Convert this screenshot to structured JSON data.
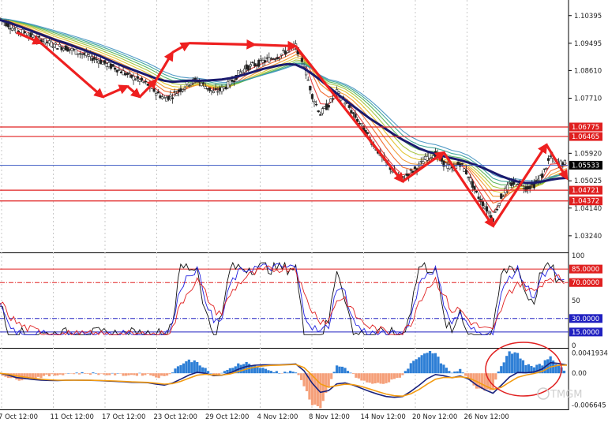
{
  "chart_data": {
    "type": "line",
    "instrument_chart": "candlestick with moving-average ribbon",
    "x_labels": [
      "7 Oct 12:00",
      "11 Oct 12:00",
      "17 Oct 12:00",
      "23 Oct 12:00",
      "29 Oct 12:00",
      "4 Nov 12:00",
      "8 Nov 12:00",
      "14 Nov 12:00",
      "20 Nov 12:00",
      "26 Nov 12:00"
    ],
    "price_axis": {
      "ticks": [
        "1.10395",
        "1.09495",
        "1.08610",
        "1.07710",
        "1.05920",
        "1.05025",
        "1.04140",
        "1.03240"
      ],
      "ylim": [
        1.0275,
        1.1085
      ],
      "current_price": "1.05533",
      "levels": [
        {
          "label": "1.06775",
          "value": 1.06775,
          "color": "#e02020",
          "tagged": true
        },
        {
          "label": "1.06465",
          "value": 1.06465,
          "color": "#e02020",
          "tagged": true
        },
        {
          "label": "1.04721",
          "value": 1.04721,
          "color": "#e02020",
          "tagged": true
        },
        {
          "label": "1.04372",
          "value": 1.04372,
          "color": "#e02020",
          "tagged": true
        }
      ],
      "current_line_color": "#3050c0",
      "series": [
        {
          "role": "close",
          "values": [
            1.103,
            1.101,
            1.099,
            1.0985,
            1.097,
            1.096,
            1.095,
            1.094,
            1.0935,
            1.0925,
            1.0915,
            1.0905,
            1.0895,
            1.088,
            1.087,
            1.0855,
            1.084,
            1.083,
            1.0815,
            1.079,
            1.077,
            1.078,
            1.08,
            1.082,
            1.083,
            1.081,
            1.079,
            1.08,
            1.082,
            1.085,
            1.087,
            1.088,
            1.089,
            1.09,
            1.091,
            1.0925,
            1.094,
            1.088,
            1.078,
            1.072,
            1.075,
            1.079,
            1.076,
            1.072,
            1.068,
            1.064,
            1.06,
            1.056,
            1.053,
            1.051,
            1.053,
            1.055,
            1.058,
            1.059,
            1.056,
            1.054,
            1.056,
            1.052,
            1.046,
            1.042,
            1.038,
            1.045,
            1.049,
            1.05,
            1.048,
            1.049,
            1.052,
            1.058,
            1.056,
            1.056
          ]
        },
        {
          "role": "ma-slow",
          "values": [
            1.1025,
            1.1018,
            1.1008,
            1.0998,
            1.0988,
            1.0978,
            1.0968,
            1.0958,
            1.095,
            1.094,
            1.093,
            1.092,
            1.091,
            1.0898,
            1.0886,
            1.0875,
            1.0865,
            1.0855,
            1.0845,
            1.0835,
            1.0828,
            1.0824,
            1.0826,
            1.0828,
            1.0828,
            1.0828,
            1.083,
            1.0832,
            1.0836,
            1.0842,
            1.085,
            1.0858,
            1.0866,
            1.0872,
            1.0878,
            1.0882,
            1.088,
            1.0868,
            1.085,
            1.083,
            1.0808,
            1.0786,
            1.0765,
            1.0745,
            1.0725,
            1.0705,
            1.0688,
            1.067,
            1.0652,
            1.0636,
            1.0622,
            1.0608,
            1.0598,
            1.059,
            1.0582,
            1.0576,
            1.057,
            1.0562,
            1.0553,
            1.0542,
            1.053,
            1.0518,
            1.0508,
            1.05,
            1.0496,
            1.0496,
            1.05,
            1.0506,
            1.051,
            1.0512
          ]
        }
      ],
      "arrows": [
        {
          "from": [
            2,
            1.0985
          ],
          "to": [
            5,
            1.095
          ]
        },
        {
          "from": [
            5,
            1.095
          ],
          "to": [
            12.5,
            1.0775
          ]
        },
        {
          "from": [
            12.5,
            1.0775
          ],
          "to": [
            15.5,
            1.081
          ]
        },
        {
          "from": [
            15.5,
            1.081
          ],
          "to": [
            17,
            1.0775
          ]
        },
        {
          "from": [
            17,
            1.0775
          ],
          "to": [
            19,
            1.083
          ]
        },
        {
          "from": [
            19,
            1.083
          ],
          "to": [
            21,
            1.092
          ]
        },
        {
          "from": [
            21,
            1.092
          ],
          "to": [
            23,
            1.095
          ]
        },
        {
          "from": [
            23,
            1.095
          ],
          "to": [
            31,
            1.0945
          ]
        },
        {
          "from": [
            31,
            1.0945
          ],
          "to": [
            36,
            1.094
          ]
        },
        {
          "from": [
            36,
            1.094
          ],
          "to": [
            49,
            1.05
          ]
        },
        {
          "from": [
            49,
            1.05
          ],
          "to": [
            54,
            1.0595
          ]
        },
        {
          "from": [
            54,
            1.0595
          ],
          "to": [
            60,
            1.0355
          ]
        },
        {
          "from": [
            60,
            1.0355
          ],
          "to": [
            66.5,
            1.062
          ]
        },
        {
          "from": [
            66.5,
            1.062
          ],
          "to": [
            69,
            1.051
          ]
        }
      ]
    },
    "stochastic_panel": {
      "ticks": [
        "100",
        "50",
        "0"
      ],
      "levels": [
        {
          "label": "85.0000",
          "value": 85,
          "color": "#e02020",
          "style": "solid"
        },
        {
          "label": "70.0000",
          "value": 70,
          "color": "#e02020",
          "style": "dashdot"
        },
        {
          "label": "30.0000",
          "value": 30,
          "color": "#2020c0",
          "style": "dashdot"
        },
        {
          "label": "15.0000",
          "value": 15,
          "color": "#2020c0",
          "style": "solid"
        }
      ],
      "ylim": [
        0,
        100
      ]
    },
    "macd_panel": {
      "ticks": [
        "0.0041934",
        "0.00",
        "-0.006645"
      ],
      "ylim": [
        -0.0072,
        0.0048
      ],
      "annotation": "red ellipse around latest histogram bars"
    },
    "colors": {
      "ribbon": [
        "#e03030",
        "#f06020",
        "#f09020",
        "#e0c020",
        "#a0c030",
        "#50b050",
        "#30a090",
        "#4090c0"
      ],
      "ma_slow": "#1a1a6e",
      "candle": "#222222",
      "arrow": "#ee2020",
      "hist_pos": "#2e7fd6",
      "hist_neg": "#f5a07a",
      "macd_line": "#1a237e",
      "signal_line": "#f39c12",
      "stoch_k": "#111111",
      "stoch_d": "#2020e0",
      "stoch_slow": "#e02020"
    },
    "watermark": "TMGM"
  }
}
